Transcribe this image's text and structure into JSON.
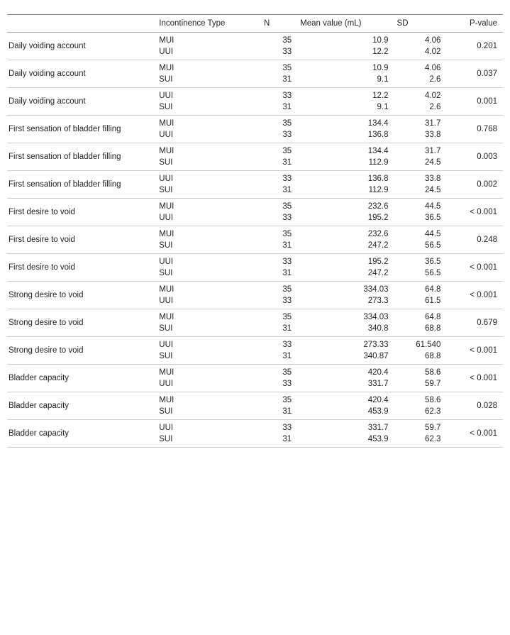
{
  "table": {
    "headers": [
      "",
      "Incontinence Type",
      "N",
      "Mean value (mL)",
      "SD",
      "P-value"
    ],
    "groups": [
      {
        "label": "Daily voiding account",
        "rows": [
          {
            "type": "MUI",
            "n": "35",
            "mean": "10.9",
            "sd": "4.06"
          },
          {
            "type": "UUI",
            "n": "33",
            "mean": "12.2",
            "sd": "4.02"
          }
        ],
        "pvalue": "0.201"
      },
      {
        "label": "Daily voiding account",
        "rows": [
          {
            "type": "MUI",
            "n": "35",
            "mean": "10.9",
            "sd": "4.06"
          },
          {
            "type": "SUI",
            "n": "31",
            "mean": "9.1",
            "sd": "2.6"
          }
        ],
        "pvalue": "0.037"
      },
      {
        "label": "Daily voiding account",
        "rows": [
          {
            "type": "UUI",
            "n": "33",
            "mean": "12.2",
            "sd": "4.02"
          },
          {
            "type": "SUI",
            "n": "31",
            "mean": "9.1",
            "sd": "2.6"
          }
        ],
        "pvalue": "0.001"
      },
      {
        "label": "First sensation of bladder filling",
        "rows": [
          {
            "type": "MUI",
            "n": "35",
            "mean": "134.4",
            "sd": "31.7"
          },
          {
            "type": "UUI",
            "n": "33",
            "mean": "136.8",
            "sd": "33.8"
          }
        ],
        "pvalue": "0.768"
      },
      {
        "label": "First sensation of bladder filling",
        "rows": [
          {
            "type": "MUI",
            "n": "35",
            "mean": "134.4",
            "sd": "31.7"
          },
          {
            "type": "SUI",
            "n": "31",
            "mean": "112.9",
            "sd": "24.5"
          }
        ],
        "pvalue": "0.003"
      },
      {
        "label": "First sensation of bladder filling",
        "rows": [
          {
            "type": "UUI",
            "n": "33",
            "mean": "136.8",
            "sd": "33.8"
          },
          {
            "type": "SUI",
            "n": "31",
            "mean": "112.9",
            "sd": "24.5"
          }
        ],
        "pvalue": "0.002"
      },
      {
        "label": "First desire to void",
        "rows": [
          {
            "type": "MUI",
            "n": "35",
            "mean": "232.6",
            "sd": "44.5"
          },
          {
            "type": "UUI",
            "n": "33",
            "mean": "195.2",
            "sd": "36.5"
          }
        ],
        "pvalue": "< 0.001"
      },
      {
        "label": "First desire to void",
        "rows": [
          {
            "type": "MUI",
            "n": "35",
            "mean": "232.6",
            "sd": "44.5"
          },
          {
            "type": "SUI",
            "n": "31",
            "mean": "247.2",
            "sd": "56.5"
          }
        ],
        "pvalue": "0.248"
      },
      {
        "label": "First desire to void",
        "rows": [
          {
            "type": "UUI",
            "n": "33",
            "mean": "195.2",
            "sd": "36.5"
          },
          {
            "type": "SUI",
            "n": "31",
            "mean": "247.2",
            "sd": "56.5"
          }
        ],
        "pvalue": "< 0.001"
      },
      {
        "label": "Strong desire to void",
        "rows": [
          {
            "type": "MUI",
            "n": "35",
            "mean": "334.03",
            "sd": "64.8"
          },
          {
            "type": "UUI",
            "n": "33",
            "mean": "273.3",
            "sd": "61.5"
          }
        ],
        "pvalue": "< 0.001"
      },
      {
        "label": "Strong desire to void",
        "rows": [
          {
            "type": "MUI",
            "n": "35",
            "mean": "334.03",
            "sd": "64.8"
          },
          {
            "type": "SUI",
            "n": "31",
            "mean": "340.8",
            "sd": "68.8"
          }
        ],
        "pvalue": "0.679"
      },
      {
        "label": "Strong desire to void",
        "rows": [
          {
            "type": "UUI",
            "n": "33",
            "mean": "273.33",
            "sd": "61.540"
          },
          {
            "type": "SUI",
            "n": "31",
            "mean": "340.87",
            "sd": "68.8"
          }
        ],
        "pvalue": "< 0.001"
      },
      {
        "label": "Bladder capacity",
        "rows": [
          {
            "type": "MUI",
            "n": "35",
            "mean": "420.4",
            "sd": "58.6"
          },
          {
            "type": "UUI",
            "n": "33",
            "mean": "331.7",
            "sd": "59.7"
          }
        ],
        "pvalue": "< 0.001"
      },
      {
        "label": "Bladder capacity",
        "rows": [
          {
            "type": "MUI",
            "n": "35",
            "mean": "420.4",
            "sd": "58.6"
          },
          {
            "type": "SUI",
            "n": "31",
            "mean": "453.9",
            "sd": "62.3"
          }
        ],
        "pvalue": "0.028"
      },
      {
        "label": "Bladder capacity",
        "rows": [
          {
            "type": "UUI",
            "n": "33",
            "mean": "331.7",
            "sd": "59.7"
          },
          {
            "type": "SUI",
            "n": "31",
            "mean": "453.9",
            "sd": "62.3"
          }
        ],
        "pvalue": "< 0.001"
      }
    ]
  }
}
